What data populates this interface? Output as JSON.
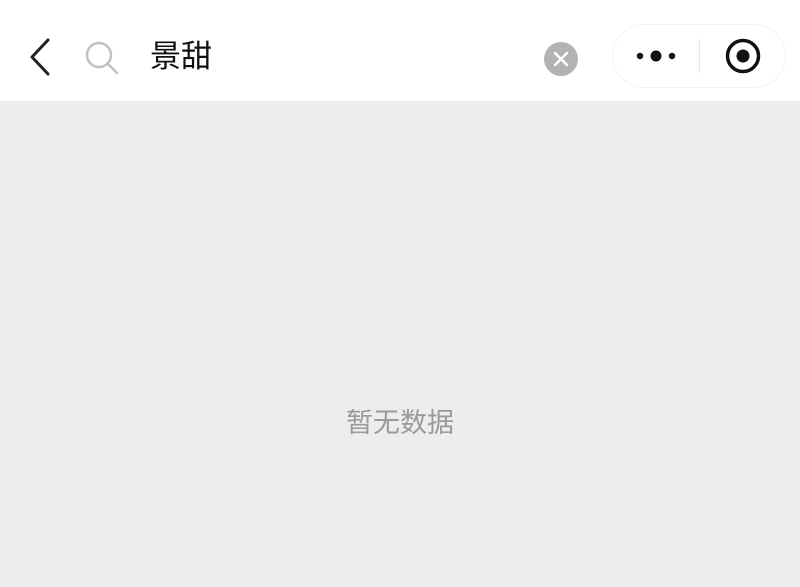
{
  "header": {
    "search": {
      "query": "景甜"
    },
    "icons": {
      "back": "chevron-left-icon",
      "search": "search-icon",
      "clear": "clear-circle-icon",
      "more": "more-dots-icon",
      "close": "target-close-icon"
    }
  },
  "content": {
    "empty_message": "暂无数据"
  },
  "colors": {
    "header_background": "#ffffff",
    "page_background": "#ededed",
    "empty_text": "#9a9a9a",
    "clear_button": "#b3b3b3"
  }
}
